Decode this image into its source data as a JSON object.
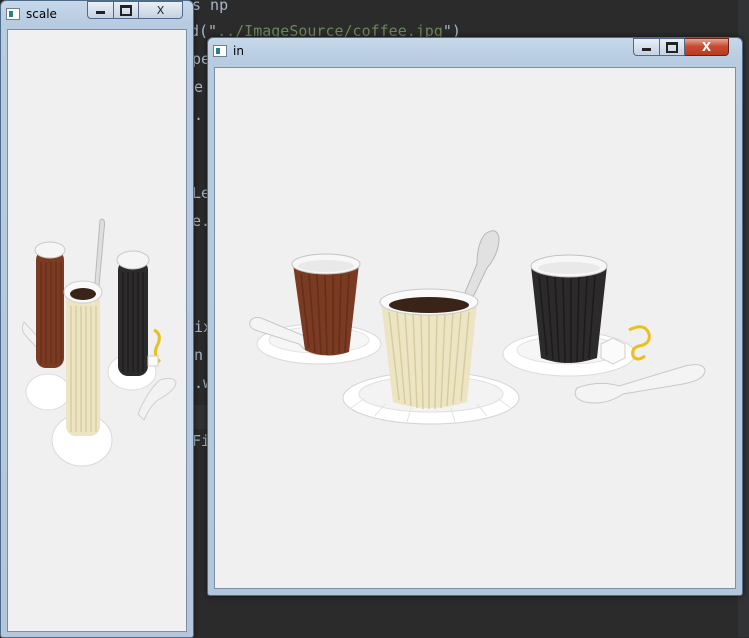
{
  "editor": {
    "lines": [
      {
        "text": "s np",
        "top": 0
      },
      {
        "text_a": "d(\"",
        "text_b": "../ImageSource/coffee.jpg",
        "text_c": "\")"
      },
      {
        "text": "pe"
      },
      {
        "text": "e"
      },
      {
        "text": "."
      },
      {
        "text": "Le"
      },
      {
        "text": "e."
      },
      {
        "text": "ix"
      },
      {
        "text": "n"
      },
      {
        "text": ".w"
      },
      {
        "text": "Fi"
      }
    ]
  },
  "windows": {
    "scale": {
      "title": "scale",
      "icon": "opencv-window-icon",
      "controls": {
        "minimize": "minimize-icon",
        "maximize": "maximize-icon",
        "close": "X"
      }
    },
    "in": {
      "title": "in",
      "icon": "opencv-window-icon",
      "controls": {
        "minimize": "minimize-icon",
        "maximize": "maximize-icon",
        "close": "X"
      }
    }
  },
  "images": {
    "scale_image": "coffee-cups-scaled",
    "in_image": "coffee-cups-original"
  },
  "colors": {
    "cup_brown": "#7a3b22",
    "cup_cream": "#ece4c2",
    "cup_dark": "#2c2a2b",
    "porcelain": "#f7f7f7",
    "lemon": "#e8c020",
    "background": "#f0f0f0"
  }
}
